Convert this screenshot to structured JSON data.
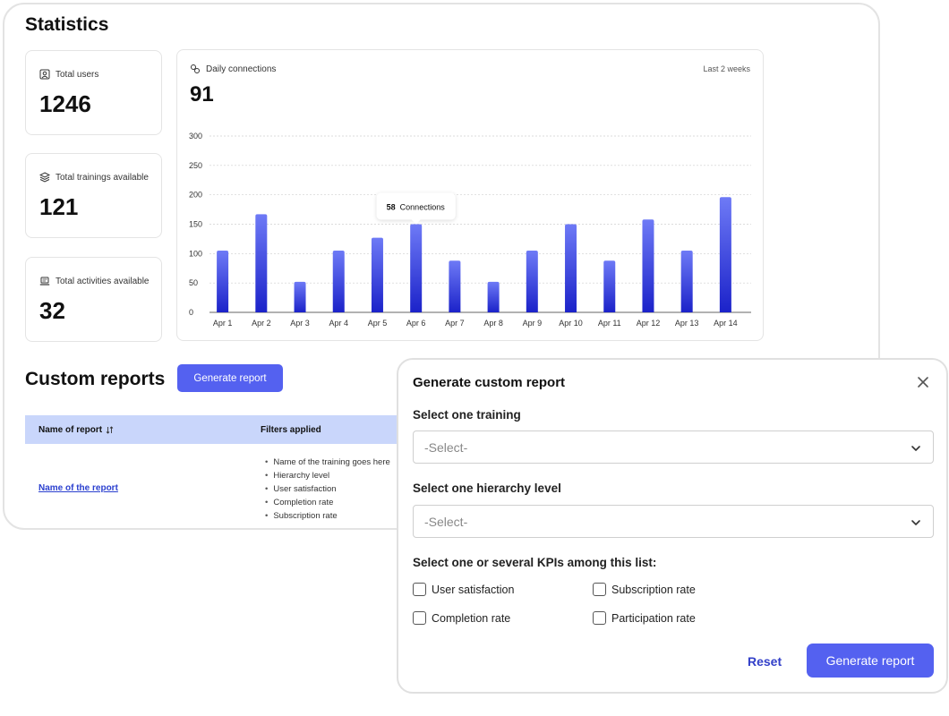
{
  "statistics": {
    "title": "Statistics",
    "cards": [
      {
        "label": "Total users",
        "value": "1246",
        "icon": "user-badge-icon"
      },
      {
        "label": "Total trainings available",
        "value": "121",
        "icon": "stack-icon"
      },
      {
        "label": "Total activities available",
        "value": "32",
        "icon": "laptop-icon"
      }
    ],
    "connections": {
      "label": "Daily connections",
      "range": "Last 2 weeks",
      "value": "91",
      "tooltip": {
        "count": "58",
        "text": "Connections"
      }
    }
  },
  "chart_data": {
    "type": "bar",
    "categories": [
      "Apr 1",
      "Apr 2",
      "Apr 3",
      "Apr 4",
      "Apr 5",
      "Apr 6",
      "Apr 7",
      "Apr 8",
      "Apr 9",
      "Apr 10",
      "Apr 11",
      "Apr 12",
      "Apr 13",
      "Apr 14"
    ],
    "values": [
      105,
      167,
      52,
      105,
      127,
      150,
      88,
      52,
      105,
      150,
      88,
      158,
      105,
      196
    ],
    "ylim": [
      0,
      300
    ],
    "yticks": [
      0,
      50,
      100,
      150,
      200,
      250,
      300
    ],
    "highlight_index": 5,
    "grid": true,
    "colors": {
      "bar_top": "#6e7af6",
      "bar_bottom": "#1b22c9",
      "grid": "#cfcfcf",
      "axis": "#333333"
    }
  },
  "reports": {
    "title": "Custom reports",
    "generate_label": "Generate report",
    "table": {
      "col_name": "Name of report",
      "col_filters": "Filters applied",
      "sort_icon": "sort-icon",
      "rows": [
        {
          "name": "Name of the report",
          "filters": [
            "Name of the training goes here",
            "Hierarchy level",
            "User satisfaction",
            "Completion rate",
            "Subscription rate"
          ]
        }
      ]
    }
  },
  "modal": {
    "title": "Generate custom report",
    "training_label": "Select one training",
    "training_placeholder": "-Select-",
    "hierarchy_label": "Select one hierarchy level",
    "hierarchy_placeholder": "-Select-",
    "kpi_label": "Select one or several KPIs among this list:",
    "kpis": [
      "User satisfaction",
      "Subscription rate",
      "Completion rate",
      "Participation rate"
    ],
    "reset_label": "Reset",
    "generate_label": "Generate report"
  },
  "colors": {
    "accent": "#5461f0",
    "table_header": "#c9d6fb",
    "link": "#2a3fcf"
  }
}
